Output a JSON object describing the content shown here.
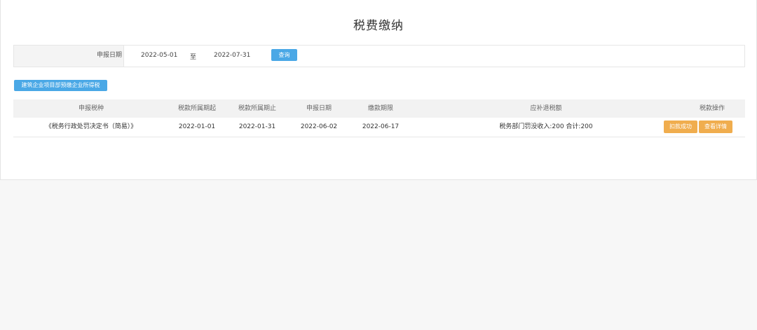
{
  "page": {
    "title": "税费缴纳"
  },
  "search": {
    "label": "申报日期",
    "date_from": "2022-05-01",
    "separator": "至",
    "date_to": "2022-07-31",
    "query_label": "查询"
  },
  "actions": {
    "tax_button_label": "建筑企业项目部预缴企业所得税"
  },
  "table": {
    "headers": [
      "申报税种",
      "税款所属期起",
      "税款所属期止",
      "申报日期",
      "缴款期限",
      "应补退税额",
      "税款操作"
    ],
    "rows": [
      {
        "tax_type": "《税务行政处罚决定书（简易）》",
        "period_start": "2022-01-01",
        "period_end": "2022-01-31",
        "declare_date": "2022-06-02",
        "due_date": "2022-06-17",
        "amount": "税务部门罚没收入:200 合计:200",
        "status_label": "扣款成功",
        "detail_label": "查看详情"
      }
    ]
  },
  "colors": {
    "primary_button": "#4aa8e6",
    "warning_button": "#f0ad4e"
  }
}
